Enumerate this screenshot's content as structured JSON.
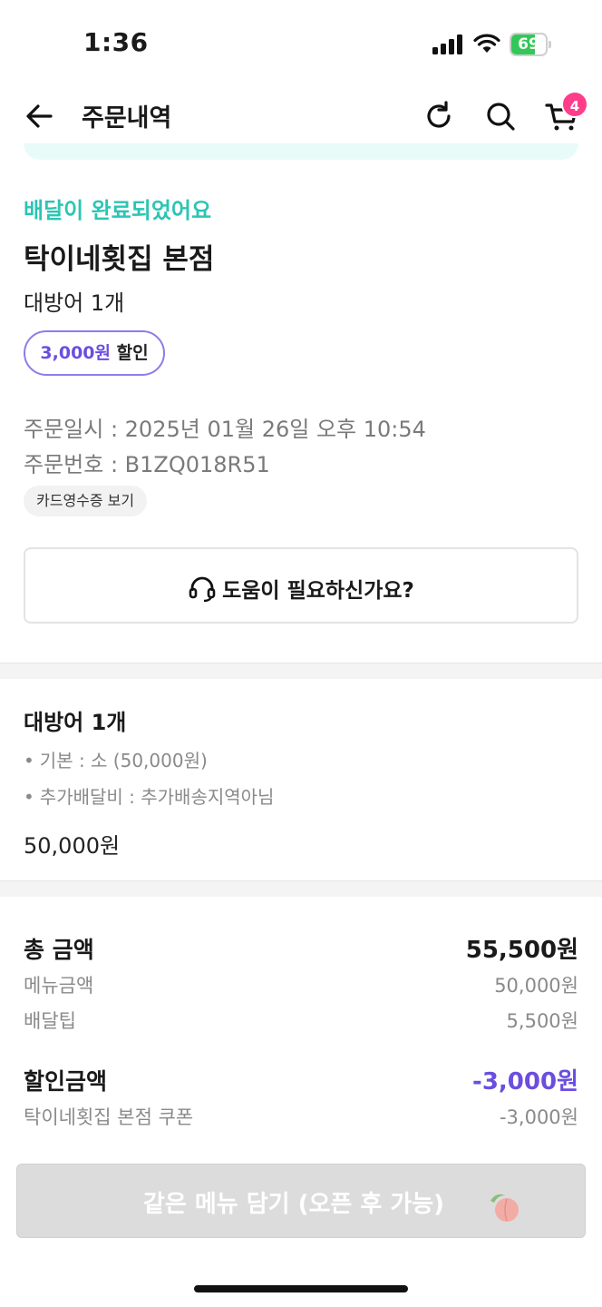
{
  "status_bar": {
    "time": "1:36",
    "battery": "69",
    "battery_level": 0.69,
    "battery_color": "#33c759"
  },
  "nav": {
    "title": "주문내역",
    "cart_count": "4",
    "badge_color": "#ff3d8b"
  },
  "order": {
    "status": "배달이 완료되었어요",
    "status_color": "#2bc5b4",
    "store": "탁이네횟집 본점",
    "summary": "대방어 1개",
    "discount_amount": "3,000원",
    "discount_word": "할인",
    "date": "주문일시 : 2025년 01월 26일 오후 10:54",
    "number": "주문번호 : B1ZQ018R51",
    "receipt_button": "카드영수증 보기",
    "help_button": "도움이 필요하신가요?"
  },
  "menu": {
    "name": "대방어 1개",
    "options": [
      "기본 : 소 (50,000원)",
      "추가배달비 : 추가배송지역아님"
    ],
    "price": "50,000원"
  },
  "totals": {
    "total_label": "총 금액",
    "total_value": "55,500원",
    "menu_label": "메뉴금액",
    "menu_value": "50,000원",
    "tip_label": "배달팁",
    "tip_value": "5,500원",
    "discount_label": "할인금액",
    "discount_value": "-3,000원",
    "coupon_label": "탁이네횟집 본점 쿠폰",
    "coupon_value": "-3,000원",
    "discount_color": "#6a4ee0"
  },
  "cta": {
    "label": "같은 메뉴 담기 (오픈 후 가능)"
  }
}
